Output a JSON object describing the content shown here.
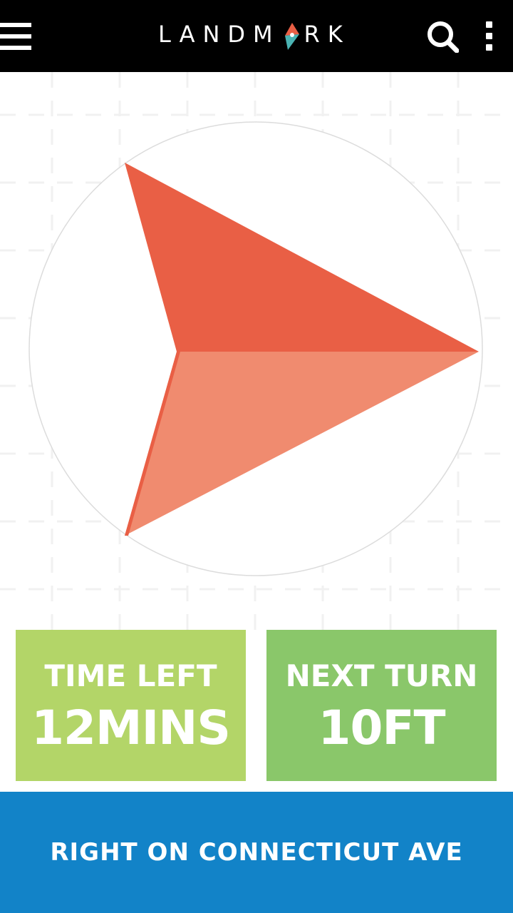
{
  "app": {
    "brand": "LANDMARK"
  },
  "header": {
    "menu_icon": "hamburger-icon",
    "search_icon": "search-icon",
    "more_icon": "more-vertical-icon"
  },
  "navigation": {
    "arrow_direction": "right",
    "arrow_icon": "navigation-arrow-icon",
    "time_left": {
      "label": "TIME LEFT",
      "value": "12MINS"
    },
    "next_turn": {
      "label": "NEXT TURN",
      "value": "10FT"
    },
    "instruction": "RIGHT ON CONNECTICUT AVE"
  },
  "colors": {
    "header_bg": "#000000",
    "arrow_dark": "#e95f45",
    "arrow_light": "#f08b6f",
    "time_card_bg": "#b3d568",
    "turn_card_bg": "#8ac76a",
    "instruction_bg": "#1283c8",
    "logo_accent_teal": "#4ab3b3",
    "logo_accent_coral": "#e95f45"
  }
}
